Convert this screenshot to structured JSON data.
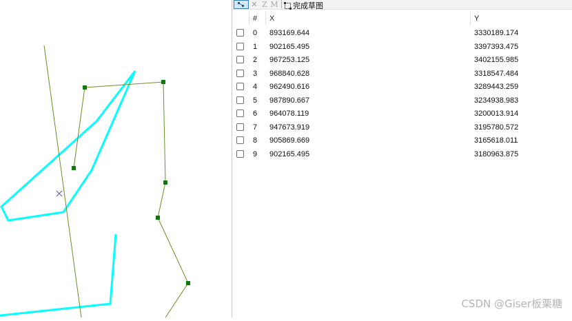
{
  "toolbar": {
    "finish_label": "完成草图",
    "edit_icon": "edit-vertices-icon",
    "delete_icon": "delete-icon",
    "z_label": "Z",
    "m_label": "M"
  },
  "table": {
    "headers": {
      "index": "#",
      "x": "X",
      "y": "Y"
    },
    "rows": [
      {
        "i": "0",
        "x": "893169.644",
        "y": "3330189.174"
      },
      {
        "i": "1",
        "x": "902165.495",
        "y": "3397393.475"
      },
      {
        "i": "2",
        "x": "967253.125",
        "y": "3402155.985"
      },
      {
        "i": "3",
        "x": "968840.628",
        "y": "3318547.484"
      },
      {
        "i": "4",
        "x": "962490.616",
        "y": "3289443.259"
      },
      {
        "i": "5",
        "x": "987890.667",
        "y": "3234938.983"
      },
      {
        "i": "6",
        "x": "964078.119",
        "y": "3200013.914"
      },
      {
        "i": "7",
        "x": "947673.919",
        "y": "3195780.572"
      },
      {
        "i": "8",
        "x": "905869.669",
        "y": "3165618.011"
      },
      {
        "i": "9",
        "x": "902165.495",
        "y": "3180963.875"
      }
    ]
  },
  "map": {
    "sketch_color": "#6b8e23",
    "vertex_color": "#0a7a0a",
    "polygon_color": "#00ffff",
    "cursor_color": "#5a5aaa"
  },
  "watermark": "CSDN @Giser板栗糖"
}
